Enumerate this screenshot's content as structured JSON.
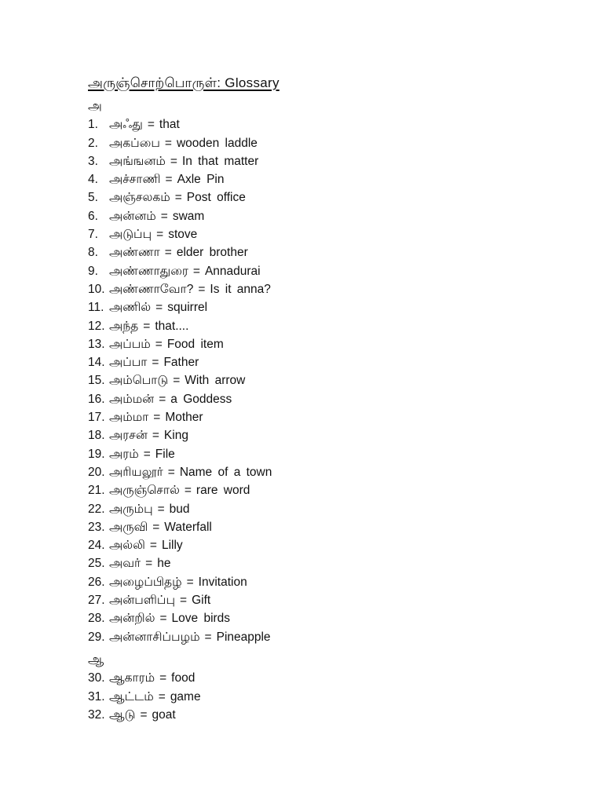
{
  "document": {
    "title": "அருஞ்சொற்பொருள்: Glossary",
    "sections": [
      {
        "letter": "அ",
        "entries": [
          {
            "num": "1.",
            "tamil": "அஃது",
            "english": "that"
          },
          {
            "num": "2.",
            "tamil": "அகப்பை",
            "english": "wooden laddle"
          },
          {
            "num": "3.",
            "tamil": "அங்ஙனம்",
            "english": "In that matter"
          },
          {
            "num": "4.",
            "tamil": "அச்சாணி",
            "english": "Axle Pin"
          },
          {
            "num": "5.",
            "tamil": "அஞ்சலகம்",
            "english": "Post office"
          },
          {
            "num": "6.",
            "tamil": "அன்னம்",
            "english": "swam"
          },
          {
            "num": "7.",
            "tamil": "அடுப்பு",
            "english": "stove"
          },
          {
            "num": "8.",
            "tamil": "அண்ணா",
            "english": "elder brother"
          },
          {
            "num": "9.",
            "tamil": "அண்ணாதுரை",
            "english": "Annadurai"
          },
          {
            "num": "10.",
            "tamil": "அண்ணாவோ?",
            "english": "Is it anna?"
          },
          {
            "num": "11.",
            "tamil": "அணில்",
            "english": "squirrel"
          },
          {
            "num": "12.",
            "tamil": "அந்த",
            "english": "that...."
          },
          {
            "num": "13.",
            "tamil": "அப்பம்",
            "english": "Food item"
          },
          {
            "num": "14.",
            "tamil": "அப்பா",
            "english": "Father"
          },
          {
            "num": "15.",
            "tamil": "அம்பொடு",
            "english": "With arrow"
          },
          {
            "num": "16.",
            "tamil": "அம்மன்",
            "english": "a Goddess"
          },
          {
            "num": "17.",
            "tamil": "அம்மா",
            "english": "Mother"
          },
          {
            "num": "18.",
            "tamil": "அரசன்",
            "english": "King"
          },
          {
            "num": "19.",
            "tamil": "அரம்",
            "english": "File"
          },
          {
            "num": "20.",
            "tamil": "அரியலூர்",
            "english": "Name of a town"
          },
          {
            "num": "21.",
            "tamil": "அருஞ்சொல்",
            "english": "rare word"
          },
          {
            "num": "22.",
            "tamil": "அரும்பு",
            "english": "bud"
          },
          {
            "num": "23.",
            "tamil": "அருவி",
            "english": "Waterfall"
          },
          {
            "num": "24.",
            "tamil": "அல்லி",
            "english": "Lilly"
          },
          {
            "num": "25.",
            "tamil": "அவர்",
            "english": "he"
          },
          {
            "num": "26.",
            "tamil": "அழைப்பிதழ்",
            "english": "Invitation"
          },
          {
            "num": "27.",
            "tamil": "அன்பளிப்பு",
            "english": "Gift"
          },
          {
            "num": "28.",
            "tamil": "அன்றில்",
            "english": "Love birds"
          },
          {
            "num": "29.",
            "tamil": "அன்னாசிப்பழம்",
            "english": "Pineapple"
          }
        ]
      },
      {
        "letter": "ஆ",
        "entries": [
          {
            "num": "30.",
            "tamil": "ஆகாரம்",
            "english": "food"
          },
          {
            "num": "31.",
            "tamil": "ஆட்டம்",
            "english": "game"
          },
          {
            "num": "32.",
            "tamil": "ஆடு",
            "english": "goat"
          }
        ]
      }
    ],
    "separator": "="
  }
}
